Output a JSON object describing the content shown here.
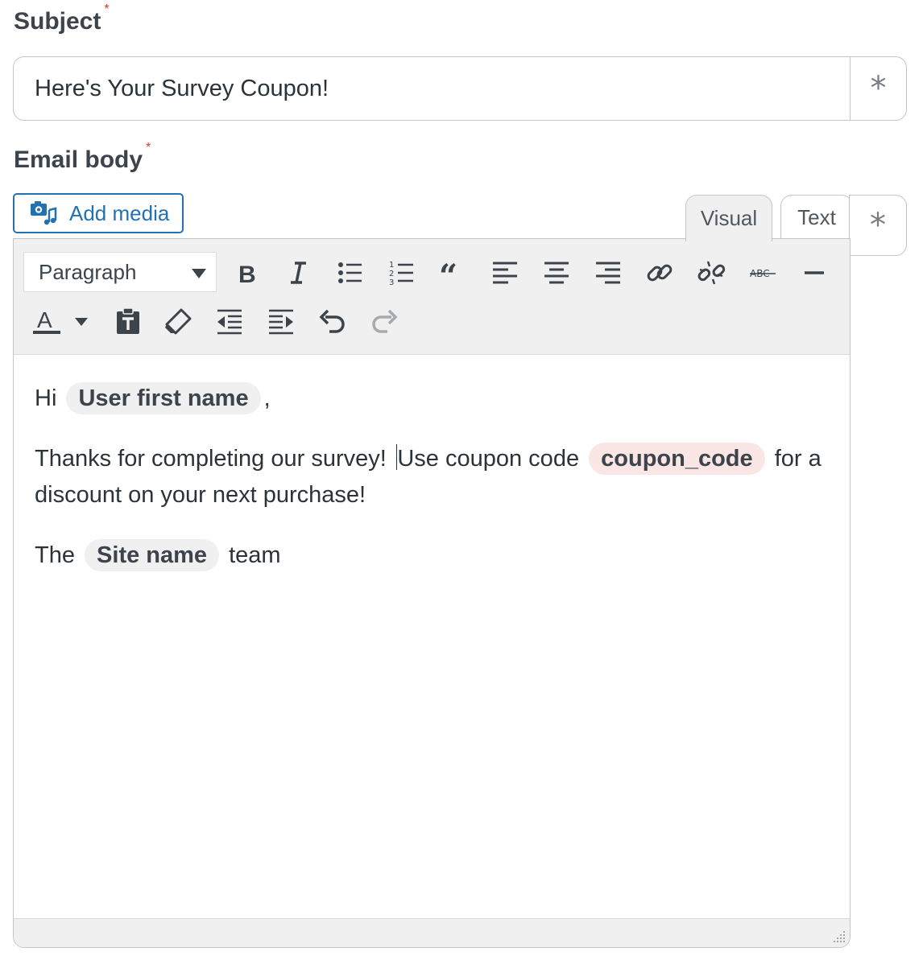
{
  "subject": {
    "label": "Subject",
    "required_mark": "*",
    "value": "Here's Your Survey Coupon!",
    "smart_tag_symbol": "*"
  },
  "body": {
    "label": "Email body",
    "required_mark": "*",
    "add_media_label": "Add media",
    "tabs": [
      {
        "label": "Visual",
        "active": true
      },
      {
        "label": "Text",
        "active": false
      }
    ],
    "smart_tag_symbol": "*",
    "toolbar": {
      "format_select": "Paragraph",
      "buttons_row1": [
        "bold-icon",
        "italic-icon",
        "bullet-list-icon",
        "numbered-list-icon",
        "blockquote-icon",
        "align-left-icon",
        "align-center-icon",
        "align-right-icon",
        "link-icon",
        "unlink-icon",
        "strikethrough-icon",
        "horizontal-line-icon"
      ],
      "buttons_row2": [
        "text-color-icon",
        "text-color-dropdown-icon",
        "paste-as-text-icon",
        "clear-formatting-icon",
        "outdent-icon",
        "indent-icon",
        "undo-icon",
        "redo-icon"
      ]
    },
    "content": {
      "line1_prefix": "Hi",
      "line1_tag": "User first name",
      "line1_suffix": ",",
      "line2_text": "Thanks for completing our survey! ",
      "line2_text_after_cursor": "Use coupon code",
      "line2_tag": "coupon_code",
      "line2_suffix": "for a discount on your next purchase!",
      "line3_prefix": "The",
      "line3_tag": "Site name",
      "line3_suffix": "team"
    }
  },
  "colors": {
    "accent": "#2271b1",
    "required": "#d63638",
    "coupon_tag_bg": "#fae6e4",
    "tag_bg": "#f0f0f1"
  }
}
